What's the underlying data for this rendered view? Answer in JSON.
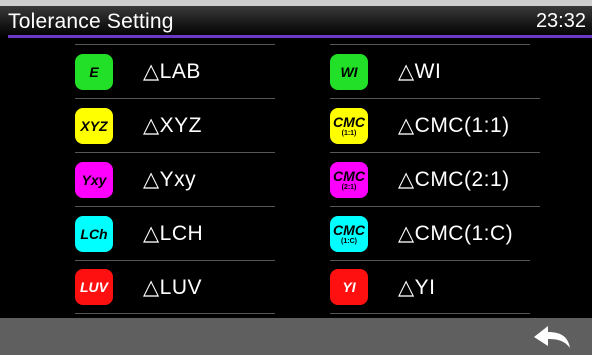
{
  "header": {
    "title": "Tolerance Setting",
    "time": "23:32"
  },
  "left_items": [
    {
      "badge": "E",
      "badge_sub": "",
      "label": "△LAB",
      "color": "#22e028",
      "text_color": "#000"
    },
    {
      "badge": "XYZ",
      "badge_sub": "",
      "label": "△XYZ",
      "color": "#ffff00",
      "text_color": "#000"
    },
    {
      "badge": "Yxy",
      "badge_sub": "",
      "label": "△Yxy",
      "color": "#ff00ff",
      "text_color": "#000"
    },
    {
      "badge": "LCh",
      "badge_sub": "",
      "label": "△LCH",
      "color": "#00ffff",
      "text_color": "#000"
    },
    {
      "badge": "LUV",
      "badge_sub": "",
      "label": "△LUV",
      "color": "#ff1010",
      "text_color": "#fff"
    }
  ],
  "right_items": [
    {
      "badge": "WI",
      "badge_sub": "",
      "label": "△WI",
      "color": "#22e028",
      "text_color": "#000"
    },
    {
      "badge": "CMC",
      "badge_sub": "(1:1)",
      "label": "△CMC(1:1)",
      "color": "#ffff00",
      "text_color": "#000"
    },
    {
      "badge": "CMC",
      "badge_sub": "(2:1)",
      "label": "△CMC(2:1)",
      "color": "#ff00ff",
      "text_color": "#000"
    },
    {
      "badge": "CMC",
      "badge_sub": "(1:C)",
      "label": "△CMC(1:C)",
      "color": "#00ffff",
      "text_color": "#000"
    },
    {
      "badge": "YI",
      "badge_sub": "",
      "label": "△YI",
      "color": "#ff1010",
      "text_color": "#fff"
    }
  ],
  "footer": {
    "back_icon": "back-arrow-icon"
  }
}
